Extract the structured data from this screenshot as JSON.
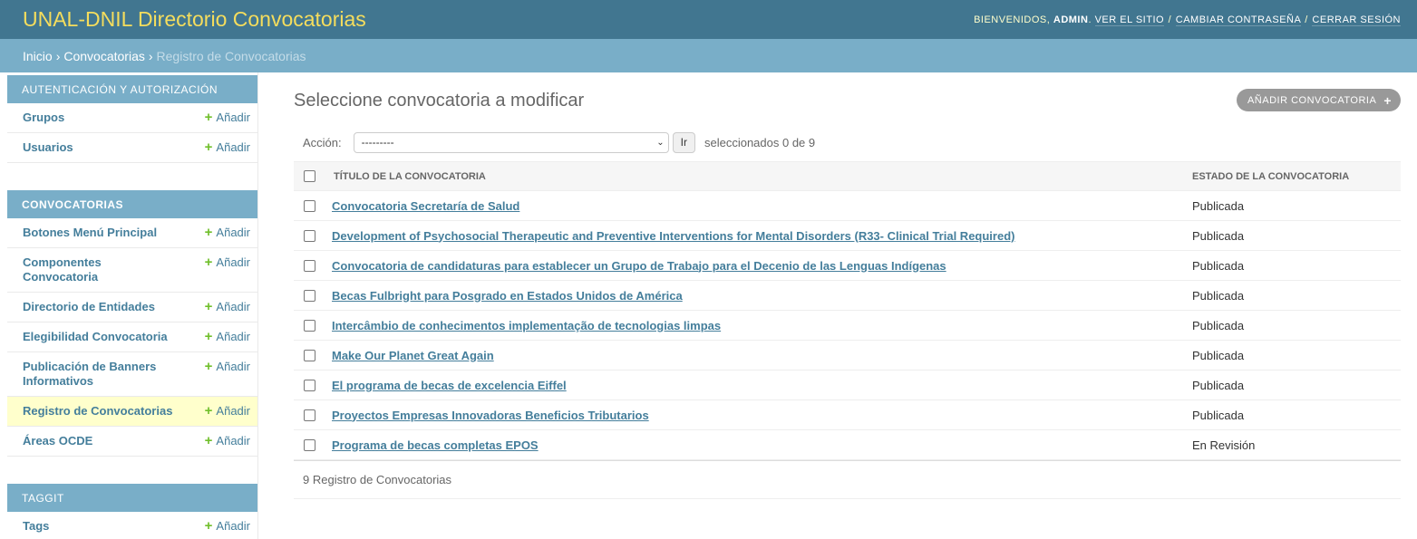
{
  "header": {
    "branding": "UNAL-DNIL Directorio Convocatorias",
    "welcome": "Bienvenidos,",
    "username": "admin",
    "view_site": "Ver el sitio",
    "change_password": "Cambiar contraseña",
    "logout": "Cerrar sesión",
    "sep": "/"
  },
  "breadcrumbs": {
    "home": "Inicio",
    "app": "Convocatorias",
    "current": "Registro de Convocatorias",
    "sep": "›"
  },
  "sidebar": {
    "add_label": "Añadir",
    "modules": [
      {
        "caption": "Autenticación y autorización",
        "items": [
          {
            "label": "Grupos"
          },
          {
            "label": "Usuarios"
          }
        ]
      },
      {
        "caption": "Convocatorias",
        "items": [
          {
            "label": "Botones Menú Principal"
          },
          {
            "label": "Componentes Convocatoria"
          },
          {
            "label": "Directorio de Entidades"
          },
          {
            "label": "Elegibilidad Convocatoria"
          },
          {
            "label": "Publicación de Banners Informativos"
          },
          {
            "label": "Registro de Convocatorias"
          },
          {
            "label": "Áreas OCDE"
          }
        ]
      },
      {
        "caption": "Taggit",
        "items": [
          {
            "label": "Tags"
          }
        ]
      }
    ]
  },
  "content": {
    "title": "Seleccione convocatoria a modificar",
    "add_button": "Añadir convocatoria",
    "action_label": "Acción:",
    "action_selected": "---------",
    "go_label": "Ir",
    "counter": "seleccionados 0 de 9",
    "columns": {
      "title": "Título de la convocatoria",
      "state": "Estado de la convocatoria"
    },
    "rows": [
      {
        "title": "Convocatoria Secretaría de Salud",
        "state": "Publicada"
      },
      {
        "title": "Development of Psychosocial Therapeutic and Preventive Interventions for Mental Disorders (R33- Clinical Trial Required)",
        "state": "Publicada"
      },
      {
        "title": "Convocatoria de candidaturas para establecer un Grupo de Trabajo para el Decenio de las Lenguas Indígenas",
        "state": "Publicada"
      },
      {
        "title": "Becas Fulbright para Posgrado en Estados Unidos de América",
        "state": "Publicada"
      },
      {
        "title": "Intercâmbio de conhecimentos implementação de tecnologias limpas",
        "state": "Publicada"
      },
      {
        "title": "Make Our Planet Great Again",
        "state": "Publicada"
      },
      {
        "title": "El programa de becas de excelencia Eiffel",
        "state": "Publicada"
      },
      {
        "title": "Proyectos Empresas Innovadoras Beneficios Tributarios",
        "state": "Publicada"
      },
      {
        "title": "Programa de becas completas EPOS",
        "state": "En Revisión"
      }
    ],
    "paginator": "9 Registro de Convocatorias"
  },
  "colors": {
    "header_bg": "#417690",
    "branding": "#f5dd5d",
    "breadcrumb_bg": "#79aec8",
    "link": "#447e9b",
    "add_plus": "#70bf2b",
    "current_row": "#ffffcc"
  }
}
